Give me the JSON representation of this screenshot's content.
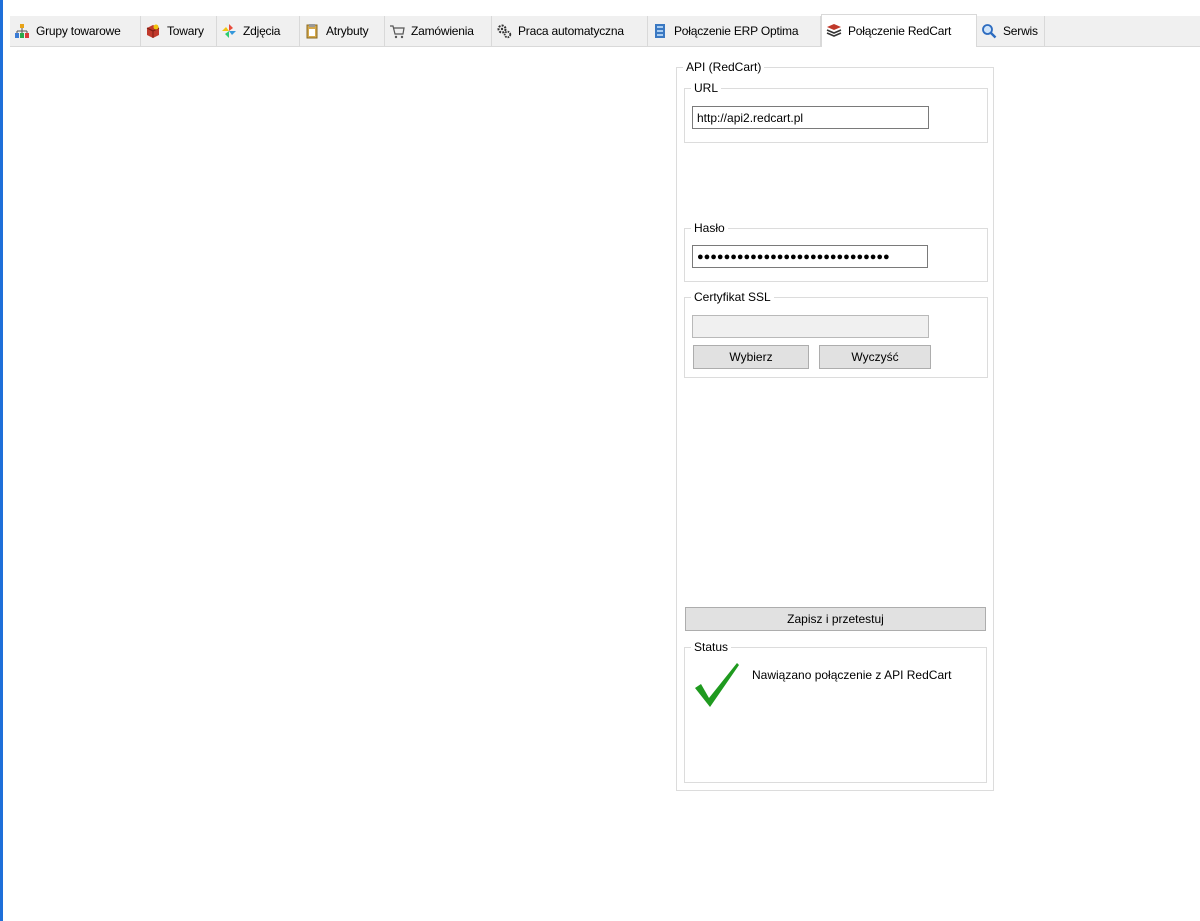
{
  "tabs": [
    {
      "label": "Grupy towarowe",
      "icon": "group-chart-icon"
    },
    {
      "label": "Towary",
      "icon": "products-icon"
    },
    {
      "label": "Zdjęcia",
      "icon": "pinwheel-icon"
    },
    {
      "label": "Atrybuty",
      "icon": "clipboard-icon"
    },
    {
      "label": "Zamówienia",
      "icon": "cart-icon"
    },
    {
      "label": "Praca automatyczna",
      "icon": "gears-icon"
    },
    {
      "label": "Połączenie ERP Optima",
      "icon": "server-icon"
    },
    {
      "label": "Połączenie RedCart",
      "icon": "stack-icon"
    },
    {
      "label": "Serwis",
      "icon": "magnifier-icon"
    }
  ],
  "active_tab": "Połączenie RedCart",
  "api_group": {
    "legend": "API (RedCart)",
    "url": {
      "legend": "URL",
      "value": "http://api2.redcart.pl"
    },
    "password": {
      "legend": "Hasło",
      "value": "●●●●●●●●●●●●●●●●●●●●●●●●●●●●●"
    },
    "ssl": {
      "legend": "Certyfikat SSL",
      "value": "",
      "choose_label": "Wybierz",
      "clear_label": "Wyczyść"
    },
    "save_test_label": "Zapisz i przetestuj",
    "status": {
      "legend": "Status",
      "message": "Nawiązano połączenie z API RedCart",
      "icon": "checkmark-icon"
    }
  },
  "colors": {
    "accent": "#1e6fd9",
    "success": "#1f9a1f"
  }
}
